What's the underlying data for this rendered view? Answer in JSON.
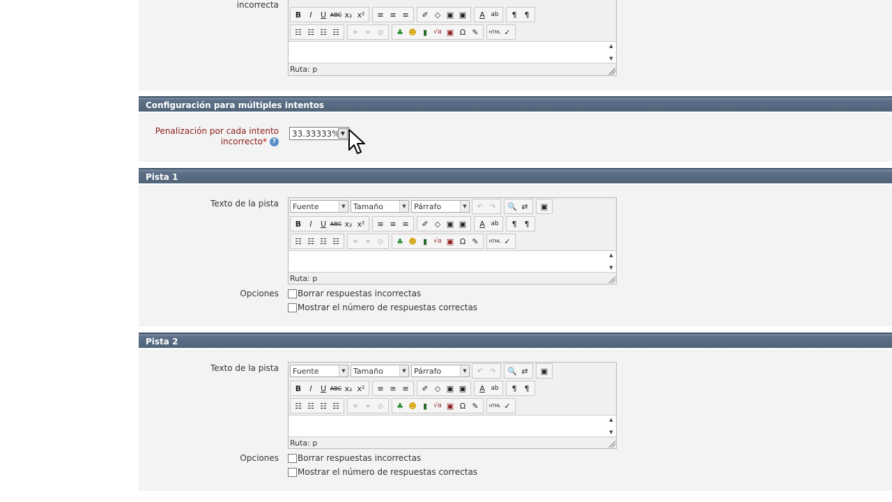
{
  "top_section": {
    "label": "incorrecta",
    "toolbar_row2": [
      "B",
      "I",
      "U",
      "ABC",
      "x₂",
      "x²",
      "≡",
      "≡",
      "≡",
      "✐",
      "◇",
      "▣",
      "▣",
      "A",
      "ab",
      "¶",
      "¶"
    ],
    "toolbar_row3": [
      "☷",
      "☷",
      "☷",
      "☷",
      "⚭",
      "⚭",
      "⊘",
      "♣",
      "☻",
      "▮",
      "√α",
      "▣",
      "Ω",
      "✎",
      "HTML",
      "✓"
    ],
    "path": "Ruta: p"
  },
  "multi_section": {
    "title": "Configuración para múltiples intentos",
    "penalty_label_line1": "Penalización por cada intento",
    "penalty_label_line2": "incorrecto",
    "required_mark": "*",
    "help_icon": "?",
    "penalty_value": "33.33333%"
  },
  "hints": [
    {
      "title": "Pista 1",
      "text_label": "Texto de la pista",
      "font_select": "Fuente",
      "size_select": "Tamaño",
      "format_select": "Párrafo",
      "path": "Ruta: p",
      "options_label": "Opciones",
      "option1": "Borrar respuestas incorrectas",
      "option2": "Mostrar el número de respuestas correctas"
    },
    {
      "title": "Pista 2",
      "text_label": "Texto de la pista",
      "font_select": "Fuente",
      "size_select": "Tamaño",
      "format_select": "Párrafo",
      "path": "Ruta: p",
      "options_label": "Opciones",
      "option1": "Borrar respuestas incorrectas",
      "option2": "Mostrar el número de respuestas correctas"
    }
  ],
  "toolbar_row1_icons": [
    "↶",
    "↷",
    "🔍",
    "⇄",
    "▣"
  ],
  "toolbar_row2": [
    "B",
    "I",
    "U",
    "ABC",
    "x₂",
    "x²",
    "≡",
    "≡",
    "≡",
    "✐",
    "◇",
    "▣",
    "▣",
    "A",
    "ab",
    "¶",
    "¶"
  ],
  "toolbar_row3": [
    "☷",
    "☷",
    "☷",
    "☷",
    "⚭",
    "⚭",
    "⊘",
    "♣",
    "☻",
    "▮",
    "√α",
    "▣",
    "Ω",
    "✎",
    "HTML",
    "✓"
  ]
}
